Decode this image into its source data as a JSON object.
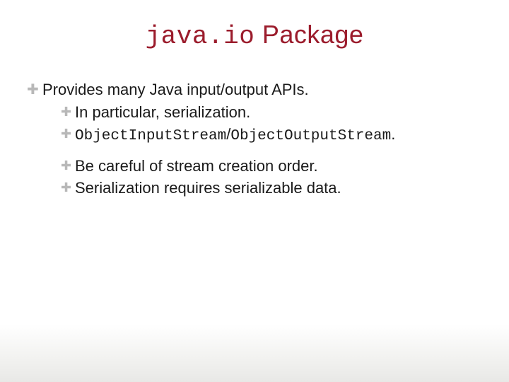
{
  "title": {
    "code": "java.io",
    "rest": " Package"
  },
  "bullets": {
    "main": "Provides many Java input/output APIs.",
    "sub1": "In particular, serialization.",
    "sub2_code1": "ObjectInputStream",
    "sub2_sep": "/",
    "sub2_code2": "ObjectOutputStream",
    "sub2_period": ".",
    "sub3": "Be careful of stream creation order.",
    "sub4": "Serialization requires serializable data."
  },
  "glyphs": {
    "plus": "✚"
  }
}
